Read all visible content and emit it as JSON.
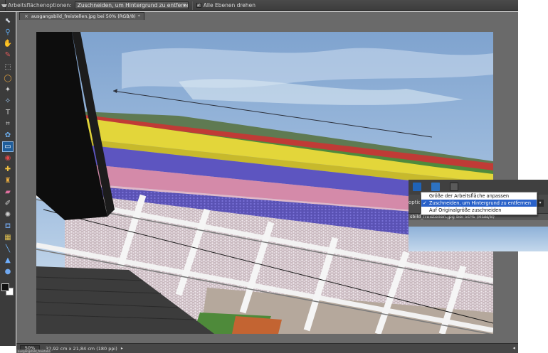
{
  "optionbar": {
    "label": "Arbeitsflächenoptionen:",
    "select_value": "Zuschneiden, um Hintergrund zu entfernen",
    "checkbox_label": "Alle Ebenen drehen",
    "checkbox_checked": true,
    "check_glyph": "✓",
    "select_arrow": "▾"
  },
  "document": {
    "tab_title": "ausgangsbild_freistellen.jpg bei 50% (RGB/8)",
    "close_glyph": "×",
    "modified_marker": "*"
  },
  "status": {
    "zoom": "50%",
    "doc_info": "32,92 cm x 21,84 cm (180 ppi)",
    "arrow": "▸",
    "right_arrow": "◂",
    "mini_tab": "ausgangsbild_freistellen"
  },
  "inset": {
    "option_fragment": "optio",
    "tab_fragment": "sbild_freistellen.jpg bei 50% (RGB/8)",
    "dropdown_items": [
      {
        "label": "Größe der Arbeitsfläche anpassen",
        "selected": false
      },
      {
        "label": "Zuschneiden, um Hintergrund zu entfernen",
        "selected": true
      },
      {
        "label": "Auf Originalgröße zuschneiden",
        "selected": false
      }
    ],
    "check_glyph": "✓",
    "select_arrow": "▾"
  },
  "tools": [
    {
      "name": "move-tool-icon",
      "glyph": "⬉"
    },
    {
      "name": "zoom-tool-icon",
      "glyph": "⚲"
    },
    {
      "name": "hand-tool-icon",
      "glyph": "✋"
    },
    {
      "name": "eyedropper-tool-icon",
      "glyph": "✎"
    },
    {
      "name": "marquee-tool-icon",
      "glyph": "⬚"
    },
    {
      "name": "lasso-tool-icon",
      "glyph": "◯"
    },
    {
      "name": "magic-wand-tool-icon",
      "glyph": "✦"
    },
    {
      "name": "quick-selection-tool-icon",
      "glyph": "✧"
    },
    {
      "name": "type-tool-icon",
      "glyph": "T"
    },
    {
      "name": "crop-tool-icon",
      "glyph": "⌗"
    },
    {
      "name": "cookie-cutter-tool-icon",
      "glyph": "✿"
    },
    {
      "name": "straighten-tool-icon",
      "glyph": "▭"
    },
    {
      "name": "red-eye-tool-icon",
      "glyph": "◉"
    },
    {
      "name": "healing-brush-tool-icon",
      "glyph": "✚"
    },
    {
      "name": "clone-stamp-tool-icon",
      "glyph": "♜"
    },
    {
      "name": "eraser-tool-icon",
      "glyph": "▰"
    },
    {
      "name": "brush-tool-icon",
      "glyph": "✐"
    },
    {
      "name": "smart-brush-tool-icon",
      "glyph": "✺"
    },
    {
      "name": "paint-bucket-tool-icon",
      "glyph": "⛾"
    },
    {
      "name": "gradient-tool-icon",
      "glyph": "▦"
    },
    {
      "name": "line-tool-icon",
      "glyph": "╲"
    },
    {
      "name": "blur-tool-icon",
      "glyph": "▲"
    },
    {
      "name": "sponge-tool-icon",
      "glyph": "●"
    }
  ],
  "colors": {
    "ui_dark": "#3b3b3b",
    "canvas_bg": "#6a6a6a",
    "menu_highlight": "#2a62c9",
    "active_tool": "#1f5d9a"
  }
}
